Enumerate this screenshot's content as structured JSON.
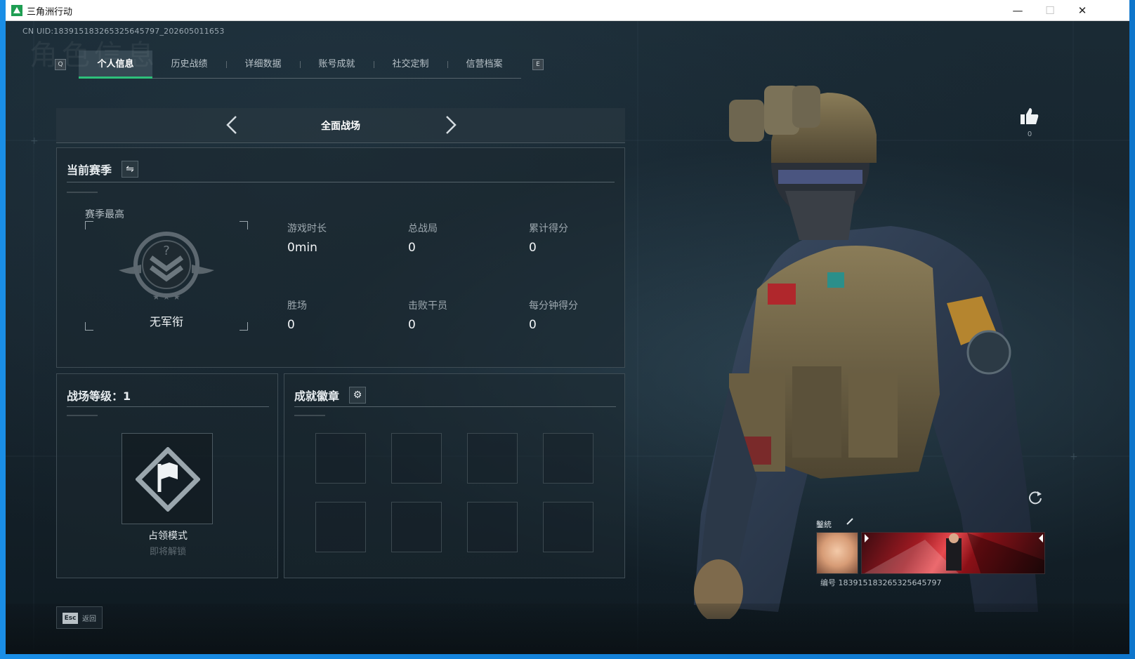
{
  "window": {
    "title": "三角洲行动",
    "minimize": "—",
    "maximize": "☐",
    "close": "✕"
  },
  "uid": "CN UID:183915183265325645797_202605011653",
  "watermark": "角色信息",
  "tabs": {
    "left_key": "Q",
    "right_key": "E",
    "items": [
      {
        "label": "个人信息",
        "active": true
      },
      {
        "label": "历史战绩",
        "active": false
      },
      {
        "label": "详细数据",
        "active": false
      },
      {
        "label": "账号成就",
        "active": false
      },
      {
        "label": "社交定制",
        "active": false
      },
      {
        "label": "信营档案",
        "active": false
      }
    ]
  },
  "mode": {
    "prev": "‹",
    "name": "全面战场",
    "next": "›"
  },
  "season": {
    "title": "当前赛季",
    "switch_icon": "⇋",
    "best_label": "赛季最高",
    "rank_name": "无军衔",
    "stats": [
      {
        "label": "游戏时长",
        "value": "0min"
      },
      {
        "label": "总战局",
        "value": "0"
      },
      {
        "label": "累计得分",
        "value": "0"
      },
      {
        "label": "胜场",
        "value": "0"
      },
      {
        "label": "击败干员",
        "value": "0"
      },
      {
        "label": "每分钟得分",
        "value": "0"
      }
    ]
  },
  "level": {
    "title": "战场等级：1",
    "mode_name": "占领模式",
    "status": "即将解锁"
  },
  "badges": {
    "title": "成就徽章",
    "settings_icon": "⚙",
    "slots": 8
  },
  "likes": {
    "count": "0"
  },
  "card": {
    "label": "鑿統",
    "id": "编号 183915183265325645797"
  },
  "footer": {
    "esc_key": "Esc",
    "back_label": "返回"
  },
  "colors": {
    "accent_green": "#2ec07a",
    "panel_bg": "#1c2830",
    "text_primary": "#e8edf0",
    "text_secondary": "#9ea9b0"
  }
}
